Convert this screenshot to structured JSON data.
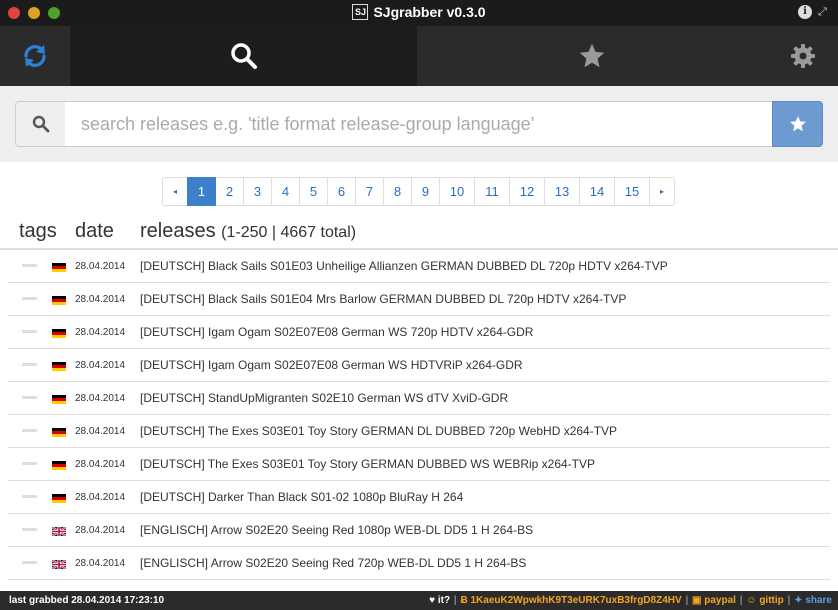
{
  "window": {
    "title": "SJgrabber v0.3.0",
    "logo_text": "SJ"
  },
  "search": {
    "placeholder": "search releases e.g. 'title format release-group language'"
  },
  "pagination": {
    "prev": "◂",
    "next": "▸",
    "pages": [
      "1",
      "2",
      "3",
      "4",
      "5",
      "6",
      "7",
      "8",
      "9",
      "10",
      "11",
      "12",
      "13",
      "14",
      "15"
    ],
    "active": "1"
  },
  "table": {
    "headers": {
      "tags": "tags",
      "date": "date",
      "releases": "releases",
      "count": "(1-250 | 4667 total)"
    },
    "rows": [
      {
        "date": "28.04.2014",
        "flag": "de",
        "name": "[DEUTSCH] Black Sails S01E03 Unheilige Allianzen GERMAN DUBBED DL 720p HDTV x264-TVP"
      },
      {
        "date": "28.04.2014",
        "flag": "de",
        "name": "[DEUTSCH] Black Sails S01E04 Mrs Barlow GERMAN DUBBED DL 720p HDTV x264-TVP"
      },
      {
        "date": "28.04.2014",
        "flag": "de",
        "name": "[DEUTSCH] Igam Ogam S02E07E08 German WS 720p HDTV x264-GDR"
      },
      {
        "date": "28.04.2014",
        "flag": "de",
        "name": "[DEUTSCH] Igam Ogam S02E07E08 German WS HDTVRiP x264-GDR"
      },
      {
        "date": "28.04.2014",
        "flag": "de",
        "name": "[DEUTSCH] StandUpMigranten S02E10 German WS dTV XviD-GDR"
      },
      {
        "date": "28.04.2014",
        "flag": "de",
        "name": "[DEUTSCH] The Exes S03E01 Toy Story GERMAN DL DUBBED 720p WebHD x264-TVP"
      },
      {
        "date": "28.04.2014",
        "flag": "de",
        "name": "[DEUTSCH] The Exes S03E01 Toy Story GERMAN DUBBED WS WEBRip x264-TVP"
      },
      {
        "date": "28.04.2014",
        "flag": "de",
        "name": "[DEUTSCH] Darker Than Black S01-02 1080p BluRay H 264"
      },
      {
        "date": "28.04.2014",
        "flag": "uk",
        "name": "[ENGLISCH] Arrow S02E20 Seeing Red 1080p WEB-DL DD5 1 H 264-BS"
      },
      {
        "date": "28.04.2014",
        "flag": "uk",
        "name": "[ENGLISCH] Arrow S02E20 Seeing Red 720p WEB-DL DD5 1 H 264-BS"
      }
    ]
  },
  "status": {
    "last_grabbed": "last grabbed 28.04.2014 17:23:10",
    "love": "♥ it?",
    "btc_address": "1KaeuK2WpwkhK9T3eURK7uxB3frgD8Z4HV",
    "paypal": "paypal",
    "gittip": "gittip",
    "share": "share"
  },
  "colors": {
    "nav_bg": "#2b2b2b",
    "nav_active_bg": "#1d1d1d",
    "accent_blue": "#3d7fc8",
    "refresh_blue": "#2e7fd6",
    "fav_button": "#6d9bd1",
    "donate_orange": "#f5a623"
  },
  "icons": {
    "refresh": "refresh-icon",
    "search": "search-icon",
    "favorites": "star-icon",
    "settings": "gear-icon",
    "info": "info-icon",
    "fullscreen": "fullscreen-icon"
  }
}
